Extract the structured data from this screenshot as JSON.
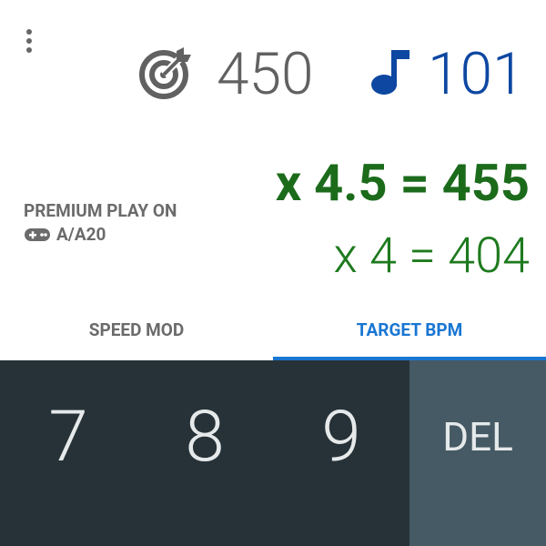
{
  "header": {
    "target_value": "450",
    "bpm_value": "101",
    "icons": {
      "target": "target-icon",
      "bpm": "music-note-icon",
      "menu": "more-vert-icon"
    }
  },
  "premium": {
    "line1": "PREMIUM PLAY ON",
    "line2": "A/A20",
    "icon": "gamepad-icon"
  },
  "results": {
    "primary": "x 4.5 = 455",
    "secondary": "x 4 = 404"
  },
  "tabs": [
    {
      "label": "SPEED MOD",
      "active": false
    },
    {
      "label": "TARGET BPM",
      "active": true
    }
  ],
  "keypad": {
    "keys": [
      "7",
      "8",
      "9"
    ],
    "delete_label": "DEL"
  },
  "colors": {
    "accent": "#1976d2",
    "bpm_blue": "#0d47a1",
    "result_green": "#1b6b1b",
    "keypad_bg": "#263238",
    "delete_bg": "#455a64"
  }
}
